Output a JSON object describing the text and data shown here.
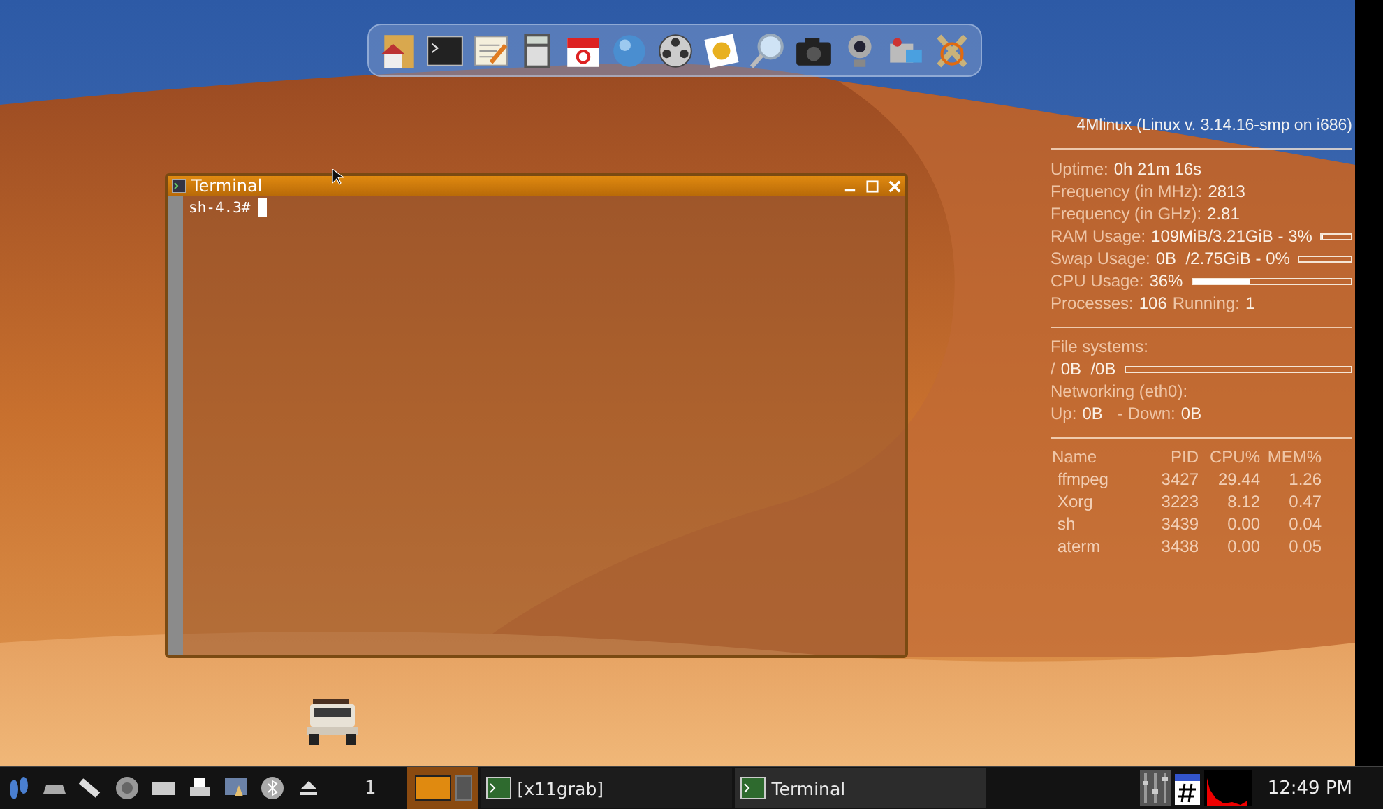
{
  "terminal": {
    "title": "Terminal",
    "prompt": "sh-4.3#"
  },
  "system_monitor": {
    "header": "4Mlinux (Linux v. 3.14.16-smp on i686)",
    "stats": [
      {
        "kind": "text",
        "parts": [
          {
            "text": "Uptime:",
            "emphasis": false
          },
          {
            "text": "0h 21m 16s",
            "emphasis": true
          }
        ]
      },
      {
        "kind": "text",
        "parts": [
          {
            "text": "Frequency (in MHz):",
            "emphasis": false
          },
          {
            "text": "2813",
            "emphasis": true
          }
        ]
      },
      {
        "kind": "text",
        "parts": [
          {
            "text": "Frequency (in GHz):",
            "emphasis": false
          },
          {
            "text": "2.81",
            "emphasis": true
          }
        ]
      },
      {
        "kind": "bar",
        "level": 0.03,
        "parts": [
          {
            "text": "RAM Usage:",
            "emphasis": false
          },
          {
            "text": "109MiB/3.21GiB - 3%",
            "emphasis": true
          }
        ]
      },
      {
        "kind": "bar",
        "level": 0,
        "parts": [
          {
            "text": "Swap Usage:",
            "emphasis": false
          },
          {
            "text": "0B  /2.75GiB - 0%",
            "emphasis": true
          }
        ]
      },
      {
        "kind": "bar",
        "level": 0.36,
        "parts": [
          {
            "text": "CPU Usage:",
            "emphasis": false
          },
          {
            "text": "36%",
            "emphasis": true
          }
        ]
      },
      {
        "kind": "text",
        "parts": [
          {
            "text": "Processes:",
            "emphasis": false
          },
          {
            "text": "106",
            "emphasis": true
          },
          {
            "text": "Running:",
            "emphasis": false
          },
          {
            "text": "1",
            "emphasis": true
          }
        ]
      }
    ],
    "storage": [
      {
        "kind": "text",
        "parts": [
          {
            "text": "File systems:",
            "emphasis": false
          }
        ]
      },
      {
        "kind": "bar",
        "level": 0,
        "parts": [
          {
            "text": "/",
            "emphasis": false
          },
          {
            "text": "0B  /0B",
            "emphasis": true
          }
        ]
      },
      {
        "kind": "text",
        "parts": [
          {
            "text": "Networking (eth0):",
            "emphasis": false
          }
        ]
      },
      {
        "kind": "text",
        "parts": [
          {
            "text": "Up:",
            "emphasis": false
          },
          {
            "text": "0B",
            "emphasis": true
          },
          {
            "text": "  - Down:",
            "emphasis": false
          },
          {
            "text": "0B",
            "emphasis": true
          }
        ]
      }
    ],
    "processes": {
      "columns": [
        "Name",
        "PID",
        "CPU%",
        "MEM%"
      ],
      "rows": [
        [
          "ffmpeg",
          "3427",
          "29.44",
          "1.26"
        ],
        [
          "Xorg",
          "3223",
          "8.12",
          "0.47"
        ],
        [
          "sh",
          "3439",
          "0.00",
          "0.04"
        ],
        [
          "aterm",
          "3438",
          "0.00",
          "0.05"
        ]
      ]
    }
  },
  "taskbar": {
    "workspace": "1",
    "pager": [
      {
        "selected": true
      },
      {
        "selected": false
      }
    ],
    "tasks": [
      {
        "label": "[x11grab]",
        "selected": false
      },
      {
        "label": "Terminal",
        "selected": true
      }
    ],
    "clock": "12:49 PM"
  }
}
